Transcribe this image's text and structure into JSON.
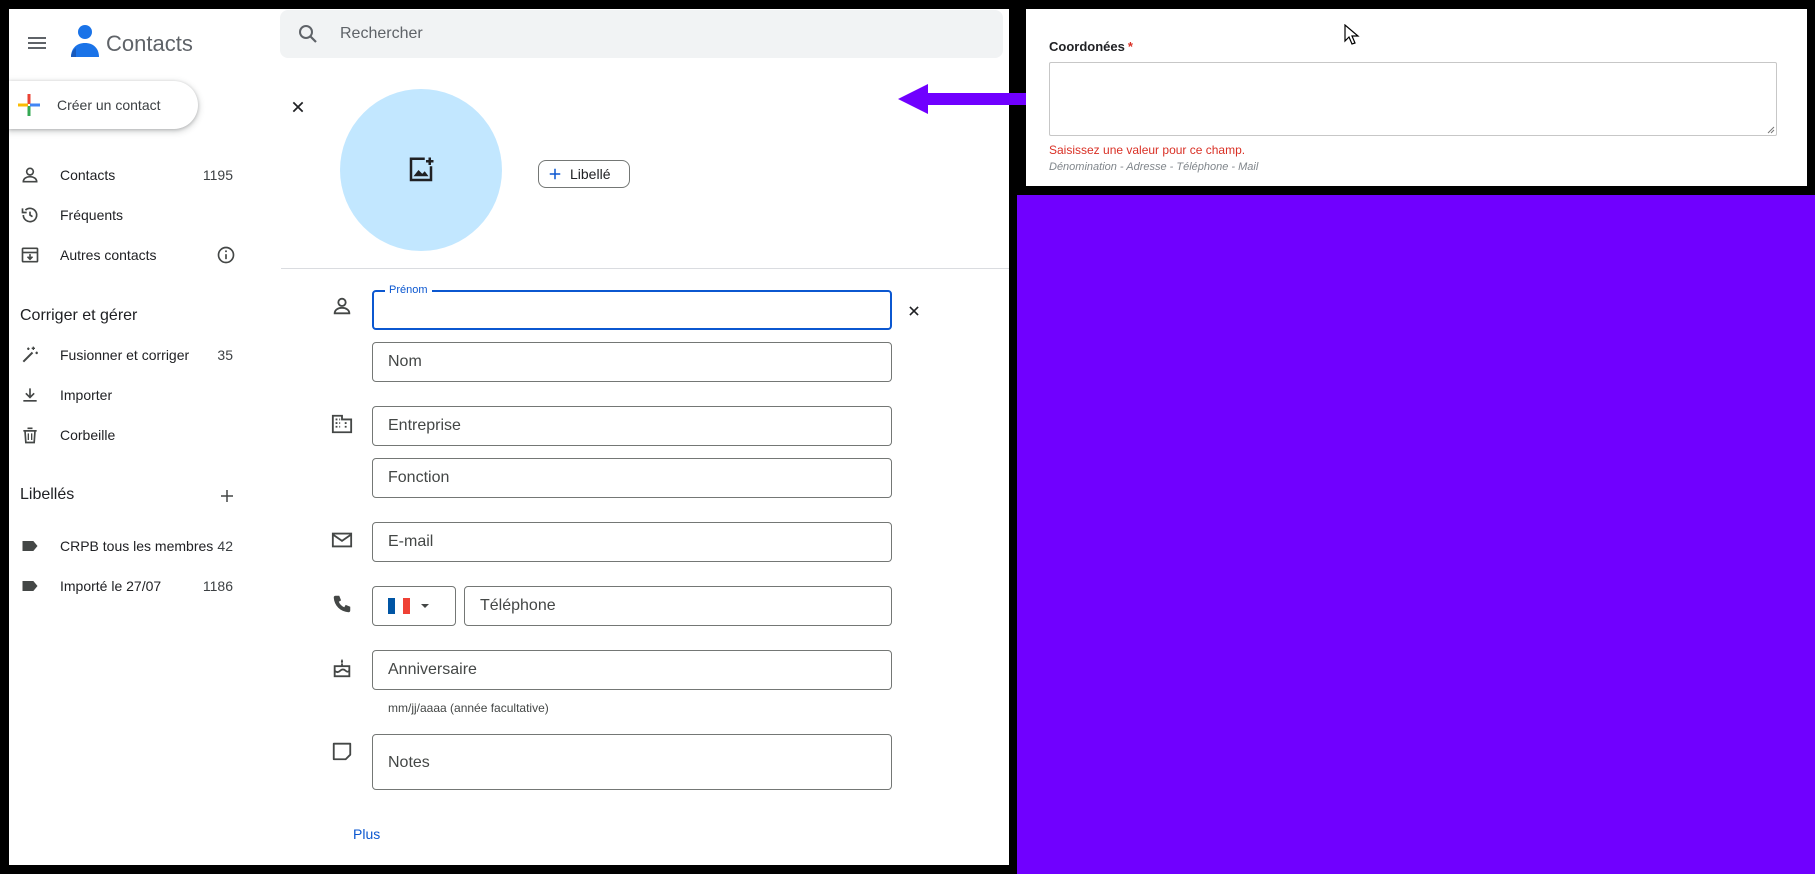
{
  "app": {
    "title": "Contacts",
    "search_placeholder": "Rechercher",
    "create_label": "Créer un contact"
  },
  "nav": {
    "contacts": {
      "label": "Contacts",
      "count": "1195"
    },
    "frequent": {
      "label": "Fréquents"
    },
    "other": {
      "label": "Autres contacts"
    }
  },
  "manage": {
    "title": "Corriger et gérer",
    "merge": {
      "label": "Fusionner et corriger",
      "count": "35"
    },
    "import": {
      "label": "Importer"
    },
    "trash": {
      "label": "Corbeille"
    }
  },
  "labels": {
    "title": "Libellés",
    "items": [
      {
        "label": "CRPB tous les membres",
        "count": "42"
      },
      {
        "label": "Importé le 27/07",
        "count": "1186"
      }
    ]
  },
  "form": {
    "label_button": "Libellé",
    "first_name_label": "Prénom",
    "last_name_placeholder": "Nom",
    "company_placeholder": "Entreprise",
    "job_placeholder": "Fonction",
    "email_placeholder": "E-mail",
    "phone_placeholder": "Téléphone",
    "birthday_placeholder": "Anniversaire",
    "birthday_helper": "mm/jj/aaaa (année facultative)",
    "notes_placeholder": "Notes",
    "more_link": "Plus"
  },
  "panel": {
    "field_label": "Coordonées",
    "required_mark": "*",
    "error": "Saisissez une valeur pour ce champ.",
    "hint": "Dénomination - Adresse - Téléphone - Mail"
  },
  "colors": {
    "accent": "#0b57d0",
    "avatar_bg": "#c2e7ff",
    "annotation_purple": "#7000ff",
    "error": "#d93025"
  }
}
